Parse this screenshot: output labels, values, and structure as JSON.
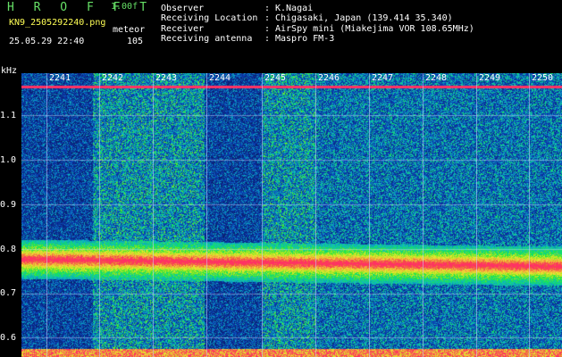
{
  "header": {
    "app_title": "H R O F F T",
    "version": "1.00f",
    "filename": "KN9_2505292240.png",
    "mode": "meteor",
    "datetime": "25.05.29 22:40",
    "count": "105",
    "info": [
      {
        "label": "Observer",
        "sep": ":",
        "value": "K.Nagai"
      },
      {
        "label": "Receiving Location",
        "sep": ":",
        "value": "Chigasaki, Japan (139.414 35.340)"
      },
      {
        "label": "Receiver",
        "sep": ":",
        "value": "AirSpy mini (Miakejima VOR 108.65MHz)"
      },
      {
        "label": "Receiving antenna",
        "sep": ":",
        "value": "Maspro FM-3"
      }
    ]
  },
  "y_axis": {
    "unit": "kHz",
    "ticks": [
      "1.1",
      "1.0",
      "0.9",
      "0.8",
      "0.7",
      "0.6"
    ]
  },
  "x_axis": {
    "ticks": [
      "2241",
      "2242",
      "2243",
      "2244",
      "2245",
      "2246",
      "2247",
      "2248",
      "2249",
      "2250"
    ]
  },
  "colors": {
    "background": "#000000",
    "waterfall_base": "#1c3a9e",
    "header_green": "#66e066",
    "header_yellow": "#ffff55",
    "signal_red": "#ff3060"
  }
}
